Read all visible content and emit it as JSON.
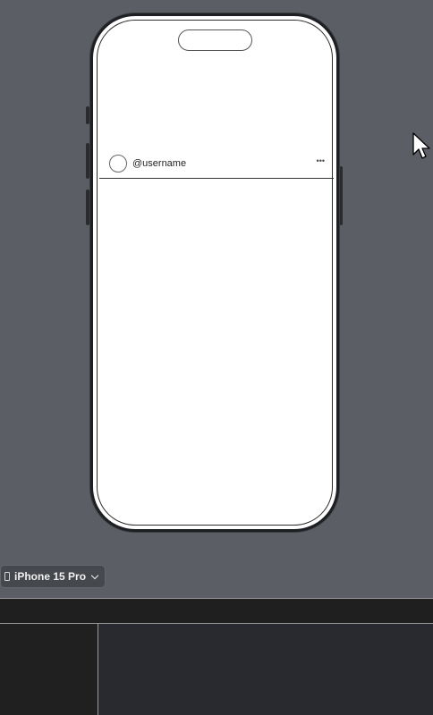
{
  "preview": {
    "post": {
      "username": "@username",
      "more_glyph": "•••"
    }
  },
  "device_selector": {
    "label": "iPhone 15 Pro"
  },
  "colors": {
    "canvas_bg": "#5b5f65",
    "phone_frame": "#1e1f22",
    "screen_bg": "#ffffff",
    "panel_dark": "#202020",
    "editor_bg": "#292a2f"
  }
}
